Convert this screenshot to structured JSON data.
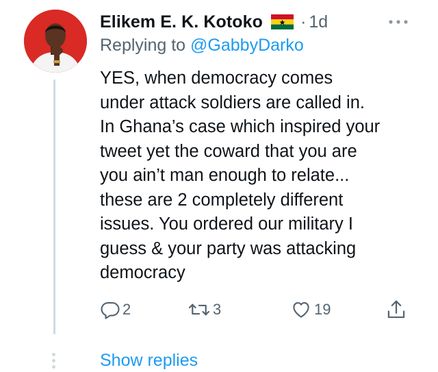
{
  "tweet": {
    "author_name": "Elikem E. K. Kotoko",
    "separator": "·",
    "time": "1d",
    "reply_prefix": "Replying to",
    "reply_handle": "@GabbyDarko",
    "text": "YES, when democracy comes\nunder attack soldiers are called in.\nIn Ghana’s case which inspired your\ntweet yet the coward that you are\nyou ain’t man enough to relate...\nthese are 2 completely different\nissues. You ordered our military I\nguess & your party was attacking\ndemocracy",
    "counts": {
      "replies": "2",
      "retweets": "3",
      "likes": "19"
    }
  },
  "show_replies_label": "Show replies",
  "icons": {
    "flag": "ghana-flag-icon",
    "more": "more-icon",
    "reply": "reply-icon",
    "retweet": "retweet-icon",
    "like": "heart-icon",
    "share": "share-icon"
  },
  "colors": {
    "text": "#0f1419",
    "secondary": "#536471",
    "link": "#1d9bf0",
    "thread_line": "#cfd9de",
    "avatar_bg": "#d92a25"
  }
}
